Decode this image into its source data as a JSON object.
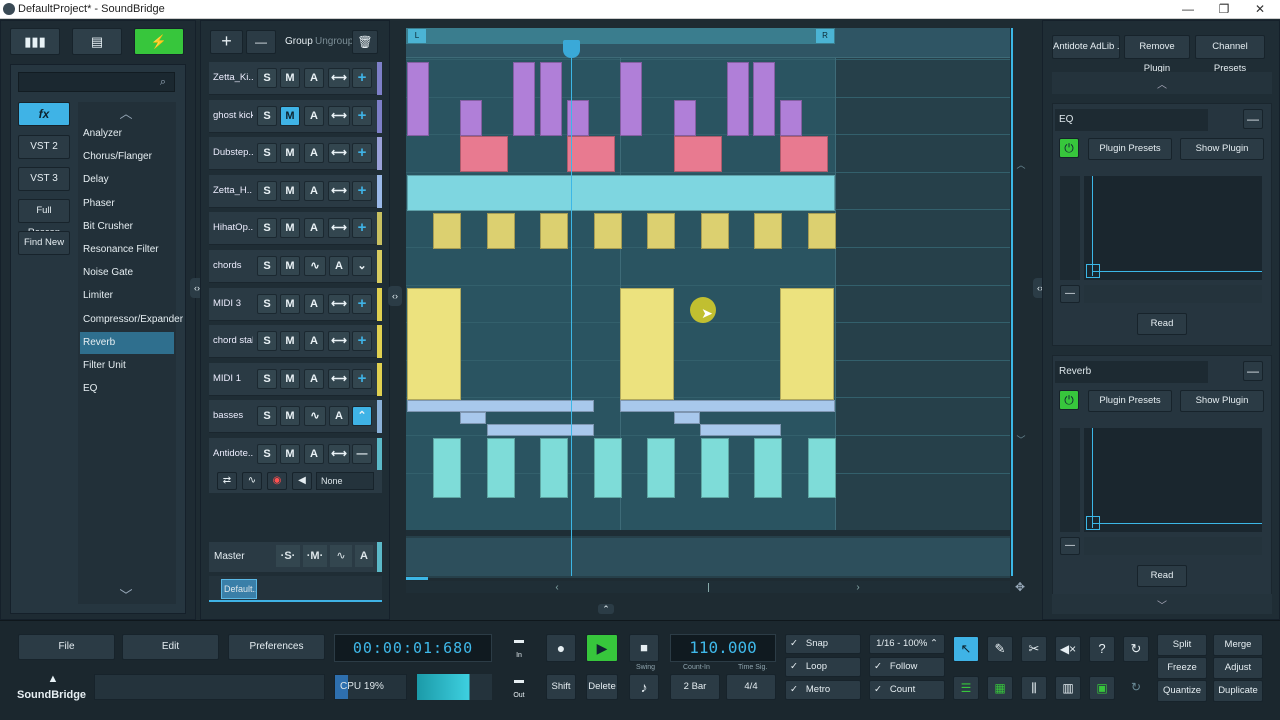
{
  "window": {
    "title": "DefaultProject* - SoundBridge",
    "min": "—",
    "restore": "❐",
    "close": "✕"
  },
  "left": {
    "fx_tab": "fx",
    "vst2": "VST 2",
    "vst3": "VST 3",
    "full_rescan": "Full Rescan",
    "find_new": "Find New",
    "search_placeholder": "",
    "effects": [
      "Analyzer",
      "Chorus/Flanger",
      "Delay",
      "Phaser",
      "Bit Crusher",
      "Resonance Filter",
      "Noise Gate",
      "Limiter",
      "Compressor/Expander",
      "Reverb",
      "Filter Unit",
      "EQ"
    ],
    "selected_effect": "Reverb"
  },
  "track_toolbar": {
    "add": "+",
    "remove": "—",
    "group": "Group",
    "ungroup": "Ungroup",
    "delete": "🗑"
  },
  "tracks": [
    {
      "name": "Zetta_Ki...",
      "color": "#7e7fc8",
      "mode": "arrow",
      "last": "+"
    },
    {
      "name": "ghost kick",
      "color": "#7e7fc8",
      "mode": "arrow",
      "last": "+",
      "m_active": true
    },
    {
      "name": "Dubstep...",
      "color": "#9aa0d8",
      "mode": "arrow",
      "last": "+"
    },
    {
      "name": "Zetta_H...",
      "color": "#9ab8e8",
      "mode": "arrow",
      "last": "+"
    },
    {
      "name": "HihatOp...",
      "color": "#c8c060",
      "mode": "arrow",
      "last": "+"
    },
    {
      "name": "chords",
      "color": "#d8cc60",
      "mode": "wave",
      "last": "⌄"
    },
    {
      "name": "MIDI 3",
      "color": "#e0d050",
      "mode": "arrow",
      "last": "+"
    },
    {
      "name": "chord stab",
      "color": "#e0d050",
      "mode": "arrow",
      "last": "+"
    },
    {
      "name": "MIDI 1",
      "color": "#e0d050",
      "mode": "arrow",
      "last": "+"
    },
    {
      "name": "basses",
      "color": "#8ab0d8",
      "mode": "wave",
      "last": "⌃"
    },
    {
      "name": "Antidote...",
      "color": "#5bb9c8",
      "mode": "arrow",
      "last": "—"
    }
  ],
  "track_labels": {
    "s": "S",
    "m": "M",
    "a": "A"
  },
  "antidote_output": "None",
  "master": {
    "name": "Master",
    "s": "·S·",
    "m": "·M·",
    "a": "A"
  },
  "project_tab": "Default...",
  "ruler": {
    "left_marker": "L",
    "right_marker": "R"
  },
  "right": {
    "plugin_name": "Antidote AdLib ...",
    "remove_plugin": "Remove Plugin",
    "channel_presets": "Channel Presets",
    "eq": {
      "title": "EQ",
      "presets": "Plugin Presets",
      "show": "Show Plugin",
      "read": "Read"
    },
    "reverb": {
      "title": "Reverb",
      "presets": "Plugin Presets",
      "show": "Show Plugin",
      "read": "Read"
    }
  },
  "transport": {
    "file": "File",
    "edit": "Edit",
    "preferences": "Preferences",
    "time": "00:00:01:680",
    "in": "In",
    "out": "Out",
    "cpu": "CPU 19%",
    "cpu_level": 0.19,
    "shift": "Shift",
    "delete": "Delete",
    "swing": "Swing",
    "count_in_label": "Count-In",
    "count_in": "2 Bar",
    "timesig_label": "Time Sig.",
    "timesig": "4/4",
    "bpm": "110.000",
    "snap": "Snap",
    "loop": "Loop",
    "metro": "Metro",
    "grid": "1/16 - 100%",
    "follow": "Follow",
    "count": "Count",
    "split": "Split",
    "merge": "Merge",
    "freeze": "Freeze",
    "adjust": "Adjust",
    "quantize": "Quantize",
    "duplicate": "Duplicate",
    "logo_text": "SoundBridge"
  }
}
